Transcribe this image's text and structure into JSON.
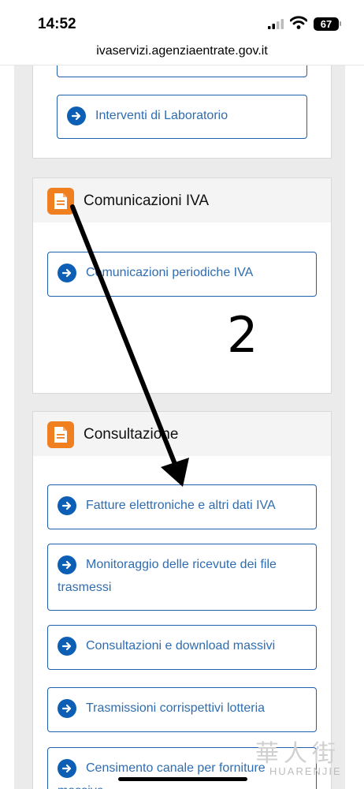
{
  "status_bar": {
    "time": "14:52",
    "battery": "67"
  },
  "url_bar": {
    "url": "ivaservizi.agenziaentrate.gov.it"
  },
  "sections": {
    "top": {
      "buttons": [
        "Interventi di Laboratorio"
      ]
    },
    "comunicazioni": {
      "title": "Comunicazioni IVA",
      "buttons": [
        "Comunicazioni periodiche IVA"
      ]
    },
    "consultazione": {
      "title": "Consultazione",
      "buttons": [
        "Fatture elettroniche e altri dati IVA",
        "Monitoraggio delle ricevute dei file",
        "trasmessi",
        "Consultazioni e download massivi",
        "Trasmissioni corrispettivi lotteria",
        "Censimento canale per forniture",
        "massive"
      ]
    }
  },
  "annotation": {
    "number": "2"
  },
  "watermark": {
    "zh": "華人街",
    "en": "HUARENJIE"
  },
  "colors": {
    "accent": "#1f5ea8",
    "icon_orange": "#f07f1f",
    "arrow_blue": "#0d5fb5"
  },
  "icons": [
    "document-icon",
    "arrow-right-circle-icon"
  ]
}
